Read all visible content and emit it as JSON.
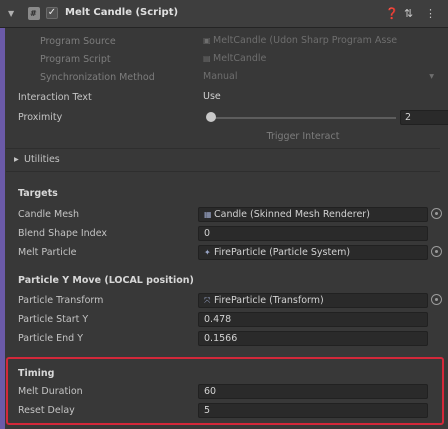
{
  "header": {
    "title": "Melt Candle (Script)",
    "checkbox": "✓",
    "fold_icon": "▼",
    "script_icon": "#",
    "icons": [
      "help-icon",
      "preset-icon",
      "more-icon"
    ]
  },
  "program": {
    "program_source_label": "Program Source",
    "program_source_value": "MeltCandle (Udon Sharp Program Asse",
    "program_script_label": "Program Script",
    "program_script_value": "MeltCandle",
    "sync_label": "Synchronization Method",
    "sync_value": "Manual"
  },
  "interaction": {
    "text_label": "Interaction Text",
    "text_value": "Use",
    "proximity_label": "Proximity",
    "proximity_value": "2",
    "proximity_level": 0.0,
    "trigger_button": "Trigger Interact"
  },
  "utilities_label": "Utilities",
  "targets": {
    "title": "Targets",
    "rows": [
      {
        "label": "Candle Mesh",
        "value": "Candle (Skinned Mesh Renderer)",
        "icon": "▦",
        "picker": true
      },
      {
        "label": "Blend Shape Index",
        "value": "0",
        "icon": "",
        "picker": false
      },
      {
        "label": "Melt Particle",
        "value": "FireParticle (Particle System)",
        "icon": "✦",
        "picker": true
      }
    ]
  },
  "particle": {
    "title": "Particle Y Move (LOCAL position)",
    "rows": [
      {
        "label": "Particle Transform",
        "value": "FireParticle (Transform)",
        "icon": "⤧",
        "picker": true
      },
      {
        "label": "Particle Start Y",
        "value": "0.478",
        "icon": "",
        "picker": false
      },
      {
        "label": "Particle End Y",
        "value": "0.1566",
        "icon": "",
        "picker": false
      }
    ]
  },
  "timing": {
    "title": "Timing",
    "rows": [
      {
        "label": "Melt Duration",
        "value": "60"
      },
      {
        "label": "Reset Delay",
        "value": "5"
      }
    ]
  },
  "colors": {
    "background": "#383838",
    "highlight": "#d3283a",
    "udon_accent": "#6b5aa8"
  }
}
